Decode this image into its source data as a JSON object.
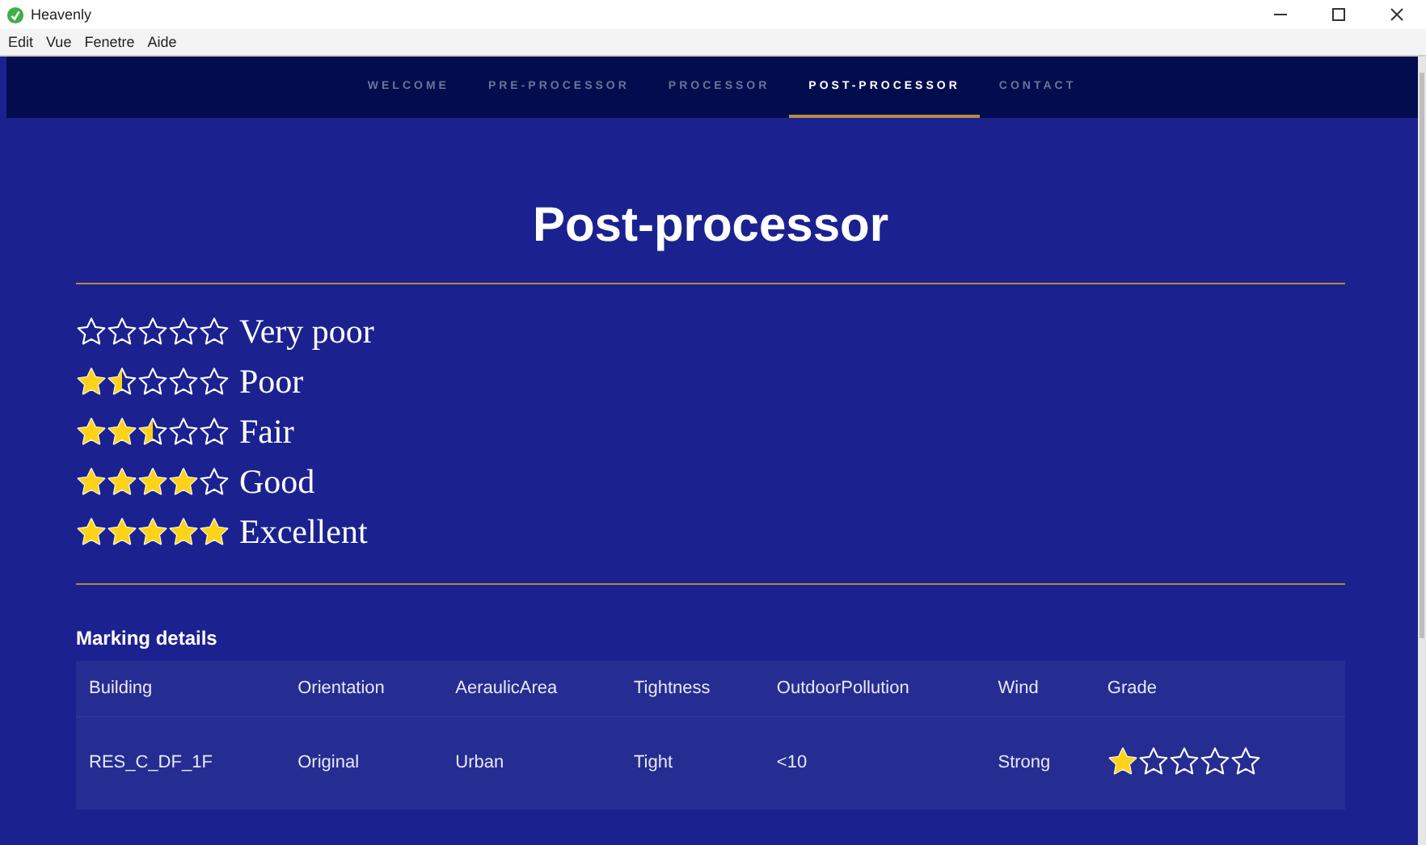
{
  "window": {
    "title": "Heavenly"
  },
  "menu": [
    "Edit",
    "Vue",
    "Fenetre",
    "Aide"
  ],
  "tabs": [
    {
      "label": "WELCOME",
      "selected": false
    },
    {
      "label": "PRE-PROCESSOR",
      "selected": false
    },
    {
      "label": "PROCESSOR",
      "selected": false
    },
    {
      "label": "POST-PROCESSOR",
      "selected": true
    },
    {
      "label": "CONTACT",
      "selected": false
    }
  ],
  "page_title": "Post-processor",
  "legend": [
    {
      "stars": 0,
      "label": "Very poor"
    },
    {
      "stars": 1.5,
      "label": "Poor"
    },
    {
      "stars": 2.5,
      "label": "Fair"
    },
    {
      "stars": 4,
      "label": "Good"
    },
    {
      "stars": 5,
      "label": "Excellent"
    }
  ],
  "section_title": "Marking details",
  "table": {
    "columns": [
      "Building",
      "Orientation",
      "AeraulicArea",
      "Tightness",
      "OutdoorPollution",
      "Wind",
      "Grade"
    ],
    "rows": [
      {
        "building": "RES_C_DF_1F",
        "orientation": "Original",
        "aeraulic_area": "Urban",
        "tightness": "Tight",
        "outdoor_pollution": "<10",
        "wind": "Strong",
        "stars": 1
      }
    ]
  }
}
